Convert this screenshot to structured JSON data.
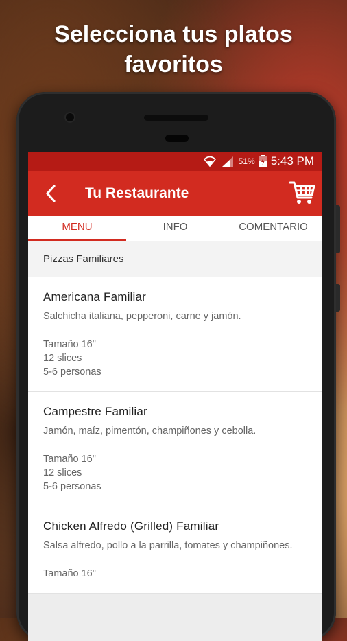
{
  "headline": {
    "line1": "Selecciona tus platos",
    "line2": "favoritos"
  },
  "status_bar": {
    "battery_pct": "51%",
    "time": "5:43 PM",
    "icons": [
      "wifi-icon",
      "signal-icon",
      "battery-icon"
    ]
  },
  "app_bar": {
    "title": "Tu Restaurante",
    "back_icon": "back-arrow-icon",
    "cart_icon": "shopping-cart-icon"
  },
  "tabs": [
    {
      "label": "MENU",
      "active": true
    },
    {
      "label": "INFO",
      "active": false
    },
    {
      "label": "COMENTARIO",
      "active": false
    }
  ],
  "section": {
    "title": "Pizzas Familiares"
  },
  "items": [
    {
      "name": "Americana Familiar",
      "description": "Salchicha italiana, pepperoni, carne y jamón.",
      "size": "Tamaño 16\"",
      "slices": "12 slices",
      "people": "5-6 personas"
    },
    {
      "name": "Campestre Familiar",
      "description": "Jamón, maíz, pimentón, champiñones y cebolla.",
      "size": "Tamaño 16\"",
      "slices": "12 slices",
      "people": "5-6 personas"
    },
    {
      "name": "Chicken Alfredo (Grilled) Familiar",
      "description": "Salsa alfredo, pollo a la parrilla, tomates y champiñones.",
      "size": "Tamaño 16\"",
      "slices": "",
      "people": ""
    }
  ],
  "colors": {
    "primary": "#d22b20",
    "status_bar": "#b51b15"
  }
}
